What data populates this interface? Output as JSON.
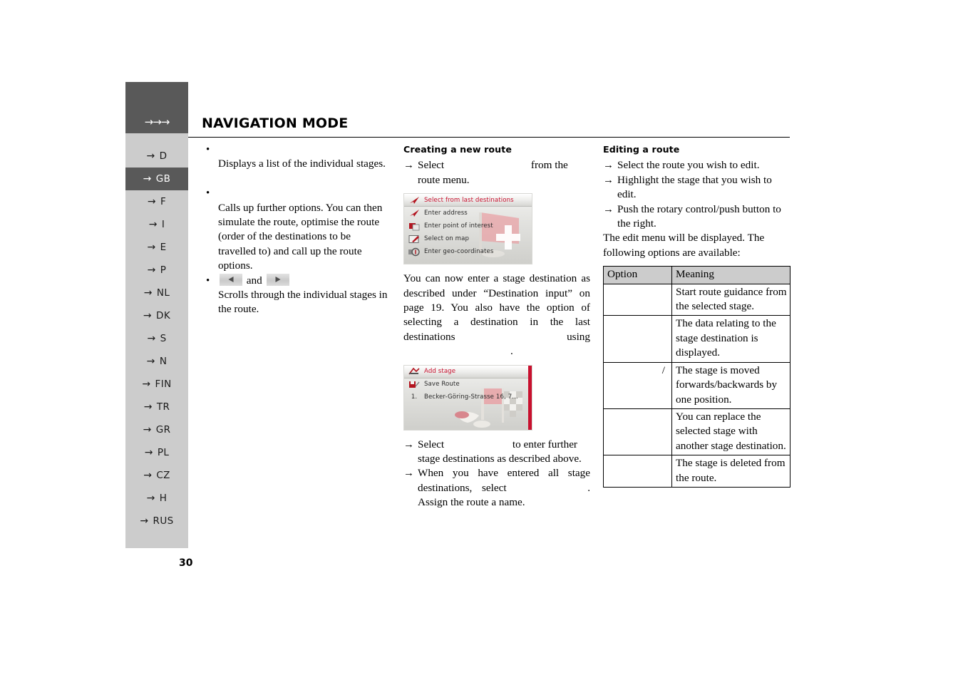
{
  "header": {
    "title": "NAVIGATION MODE",
    "arrows": "→→→"
  },
  "page_number": "30",
  "sidebar": {
    "items": [
      {
        "label": "D",
        "active": false
      },
      {
        "label": "GB",
        "active": true
      },
      {
        "label": "F",
        "active": false
      },
      {
        "label": "I",
        "active": false
      },
      {
        "label": "E",
        "active": false
      },
      {
        "label": "P",
        "active": false
      },
      {
        "label": "NL",
        "active": false
      },
      {
        "label": "DK",
        "active": false
      },
      {
        "label": "S",
        "active": false
      },
      {
        "label": "N",
        "active": false
      },
      {
        "label": "FIN",
        "active": false
      },
      {
        "label": "TR",
        "active": false
      },
      {
        "label": "GR",
        "active": false
      },
      {
        "label": "PL",
        "active": false
      },
      {
        "label": "CZ",
        "active": false
      },
      {
        "label": "H",
        "active": false
      },
      {
        "label": "RUS",
        "active": false
      }
    ],
    "arrow_glyph": "→"
  },
  "left_column": {
    "bullet_1_text": "Displays a list of the individual stages.",
    "bullet_2_text": "Calls up further options. You can then simulate the route, optimise the route (order of the destinations to be travelled to) and call up the route options.",
    "bullet_3_conjunction": "and",
    "bullet_3_text": "Scrolls through the individual stages in the route."
  },
  "middle_column": {
    "heading": "Creating a new route",
    "step_1_pre": "Select",
    "step_1_post": "from the route menu.",
    "screenshot_1": {
      "rows": [
        {
          "label": "Select from last destinations",
          "icon": "navigation-arrow-icon",
          "selected": true
        },
        {
          "label": "Enter address",
          "icon": "navigation-arrow-icon",
          "selected": false
        },
        {
          "label": "Enter point of interest",
          "icon": "poi-icon",
          "selected": false
        },
        {
          "label": "Select on map",
          "icon": "map-pencil-icon",
          "selected": false
        },
        {
          "label": "Enter geo-coordinates",
          "icon": "geo-coordinates-icon",
          "selected": false
        }
      ]
    },
    "paragraph": "You can now enter a stage destination as described under “Destination input” on page 19. You also have the option of selecting a destination in the last destinations using",
    "paragraph_end": ".",
    "screenshot_2": {
      "rows": [
        {
          "label": "Add stage",
          "icon": "add-stage-flag-icon",
          "selected": true,
          "number": ""
        },
        {
          "label": "Save Route",
          "icon": "save-route-icon",
          "selected": false,
          "number": ""
        },
        {
          "label": "Becker-Göring-Strasse 16, 7...",
          "icon": "",
          "selected": false,
          "number": "1."
        }
      ]
    },
    "step_2_pre": "Select",
    "step_2_post": "to enter further stage destinations as described above.",
    "step_3_pre": "When you have entered all stage destinations, select",
    "step_3_post": ". Assign the route a name."
  },
  "right_column": {
    "heading": "Editing a route",
    "steps": [
      "Select the route you wish to edit.",
      "Highlight the stage that you wish to edit.",
      "Push the rotary control/push button to the right."
    ],
    "paragraph": "The edit menu will be displayed. The following options are available:",
    "table": {
      "headers": [
        "Option",
        "Meaning"
      ],
      "rows": [
        {
          "option": "",
          "meaning": "Start route guidance from the selected stage."
        },
        {
          "option": "",
          "meaning": "The data relating to the stage destination is displayed."
        },
        {
          "option": "/",
          "meaning": "The stage is moved forwards/backwards by one position."
        },
        {
          "option": "",
          "meaning": "You can replace the selected stage with another stage destination."
        },
        {
          "option": "",
          "meaning": "The stage is deleted from the route."
        }
      ]
    }
  },
  "colors": {
    "sidebar_dark": "#595959",
    "sidebar_light": "#cccccc",
    "accent_red": "#c8102e",
    "text": "#000000"
  }
}
